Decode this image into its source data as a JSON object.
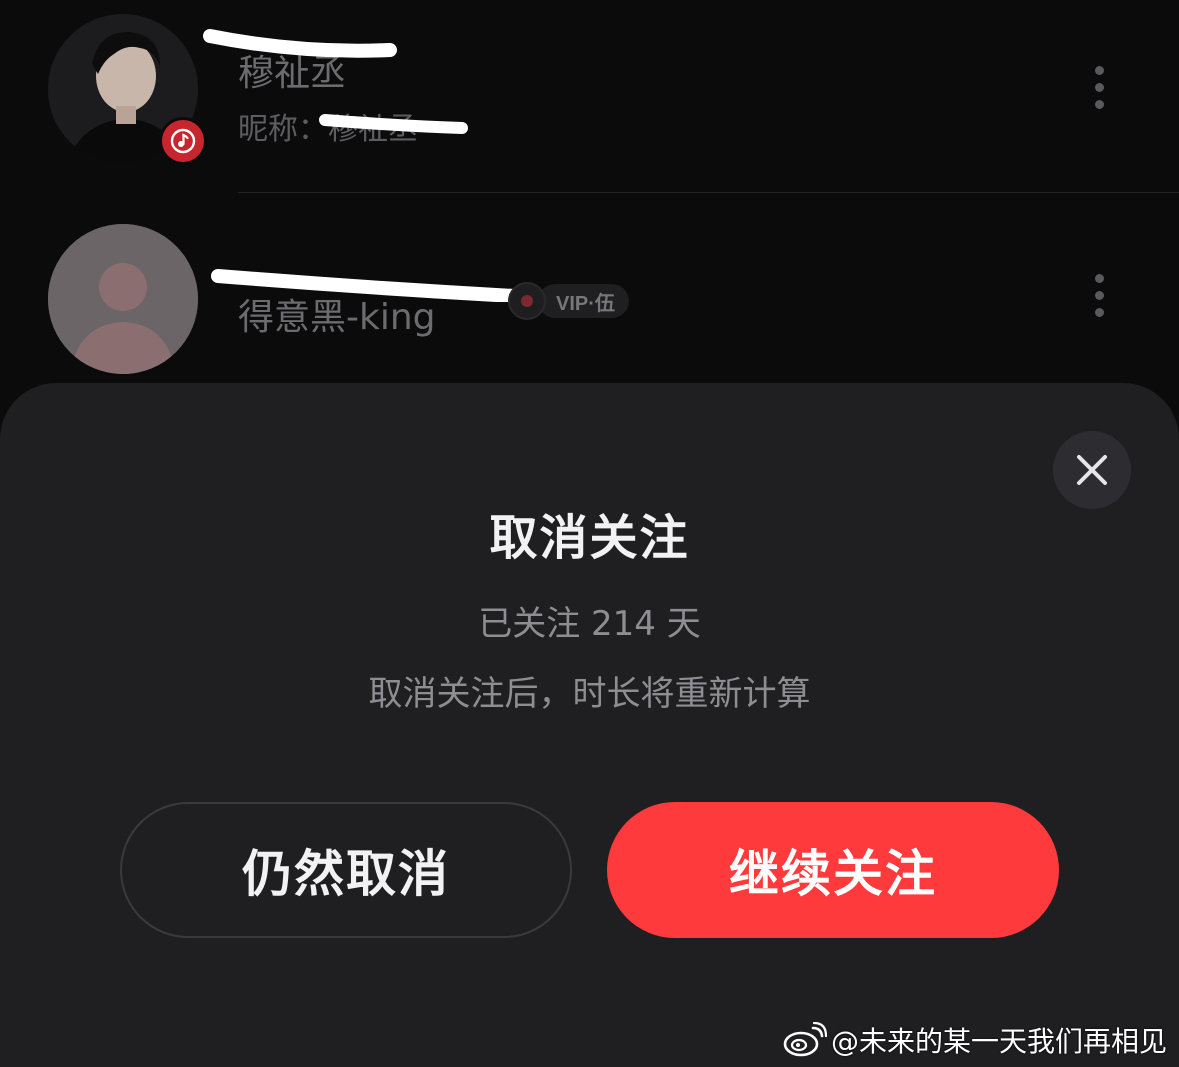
{
  "list": {
    "rows": [
      {
        "name": "穆祉丞",
        "nickname": "昵称：穆祉丞",
        "avatar_icon": "person-photo-avatar",
        "badge_icon": "music-note-icon",
        "more_icon": "more-vertical-icon"
      },
      {
        "name": "得意黑-king",
        "vip_label": "VIP·伍",
        "avatar_icon": "default-user-avatar",
        "vinyl_icon": "vinyl-record-icon",
        "more_icon": "more-vertical-icon"
      }
    ]
  },
  "dialog": {
    "title": "取消关注",
    "followed_days_text": "已关注 214 天",
    "notice_text": "取消关注后，时长将重新计算",
    "close_icon": "close-icon",
    "cancel_button": "仍然取消",
    "keep_button": "继续关注"
  },
  "watermark": {
    "text": "@未来的某一天我们再相见",
    "icon": "weibo-logo-icon"
  },
  "colors": {
    "background": "#0b0b0c",
    "sheet": "#1f1f22",
    "accent_red": "#ff3a3c",
    "title_text": "#f2f2f4",
    "secondary_text": "#8d8d92"
  }
}
